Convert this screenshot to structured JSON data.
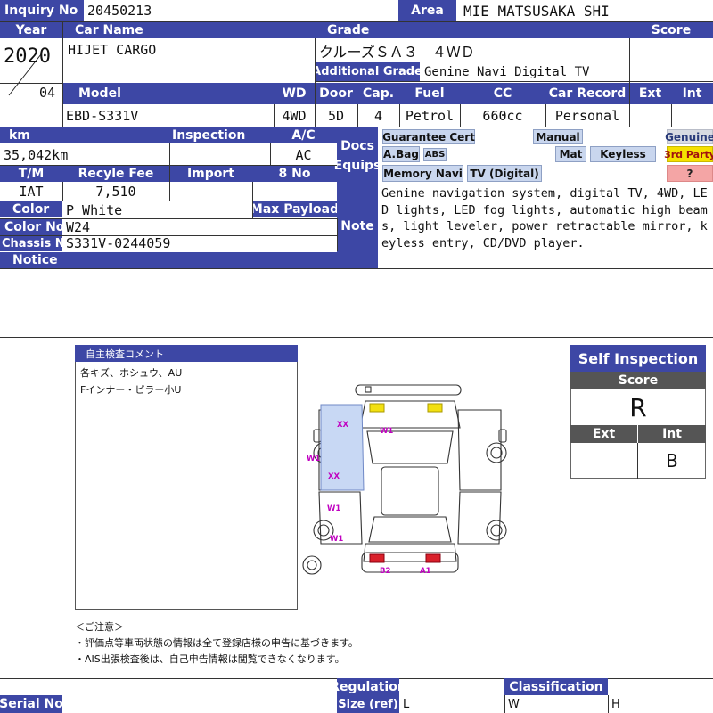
{
  "header": {
    "inquiry_no_label": "Inquiry No",
    "inquiry_no": "20450213",
    "area_label": "Area",
    "area": "MIE MATSUSAKA SHI",
    "year_label": "Year",
    "car_name_label": "Car Name",
    "grade_label": "Grade",
    "score_label": "Score",
    "year": "2020",
    "month": "04",
    "car_name": "HIJET CARGO",
    "grade": "クルーズＳＡ３　４ＷＤ",
    "additional_grade_label": "Additional Grade",
    "additional_grade": "Genine Navi Digital TV"
  },
  "specs": {
    "model_label": "Model",
    "wd_label": "WD",
    "door_label": "Door",
    "cap_label": "Cap.",
    "fuel_label": "Fuel",
    "cc_label": "CC",
    "car_record_label": "Car Record",
    "ext_label": "Ext",
    "int_label": "Int",
    "model": "EBD-S331V",
    "wd": "4WD",
    "door": "5D",
    "cap": "4",
    "fuel": "Petrol",
    "cc": "660cc",
    "car_record": "Personal"
  },
  "details": {
    "km_label": "km",
    "inspection_label": "Inspection",
    "ac_label": "A/C",
    "km": "35,042km",
    "ac": "AC",
    "tm_label": "T/M",
    "recycle_fee_label": "Recyle Fee",
    "import_label": "Import",
    "no_label": "8 No",
    "tm": "IAT",
    "recycle_fee": "7,510",
    "color_label": "Color",
    "color": "P White",
    "max_payload_label": "Max Payload",
    "color_no_label": "Color No",
    "color_no": "W24",
    "chassis_no_label": "Chassis No",
    "chassis_no": "S331V-0244059",
    "notice_label": "Notice"
  },
  "equipment": {
    "docs_label_1": "Docs",
    "docs_label_2": "Equips",
    "guarantee_cert": "Guarantee Cert",
    "manual": "Manual",
    "genuine": "Genuine",
    "abag": "A.Bag",
    "abs": "ABS",
    "mat": "Mat",
    "keyless": "Keyless",
    "third_party": "3rd Party",
    "memory_navi": "Memory Navi",
    "tv_digital": "TV (Digital)",
    "question": "?"
  },
  "note": {
    "label": "Note",
    "text": "Genine navigation system, digital TV, 4WD, LED lights, LED fog lights, automatic high beams, light leveler, power retractable mirror, keyless entry, CD/DVD player."
  },
  "comments": {
    "title": "自主検査コメント",
    "line1": "各キズ、ホシュウ、AU",
    "line2": "Fインナー・ピラー小U"
  },
  "diagram": {
    "marks": [
      "XX",
      "W1",
      "W1",
      "XX",
      "W1",
      "W1",
      "B2",
      "A1"
    ]
  },
  "self_inspection": {
    "title": "Self Inspection",
    "score_label": "Score",
    "score": "R",
    "ext_label": "Ext",
    "int_label": "Int",
    "ext": "",
    "int": "B"
  },
  "disclaimer": {
    "heading": "＜ご注意＞",
    "line1": "・評価点等車両状態の情報は全て登録店様の申告に基づきます。",
    "line2": "・AIS出張検査後は、自己申告情報は閲覧できなくなります。"
  },
  "footer": {
    "serial_no_label": "Serial No",
    "regulation_label": "Regulation",
    "size_label": "Size (ref)",
    "classification_label": "Classification",
    "l_label": "L",
    "w_label": "W",
    "h_label": "H"
  }
}
